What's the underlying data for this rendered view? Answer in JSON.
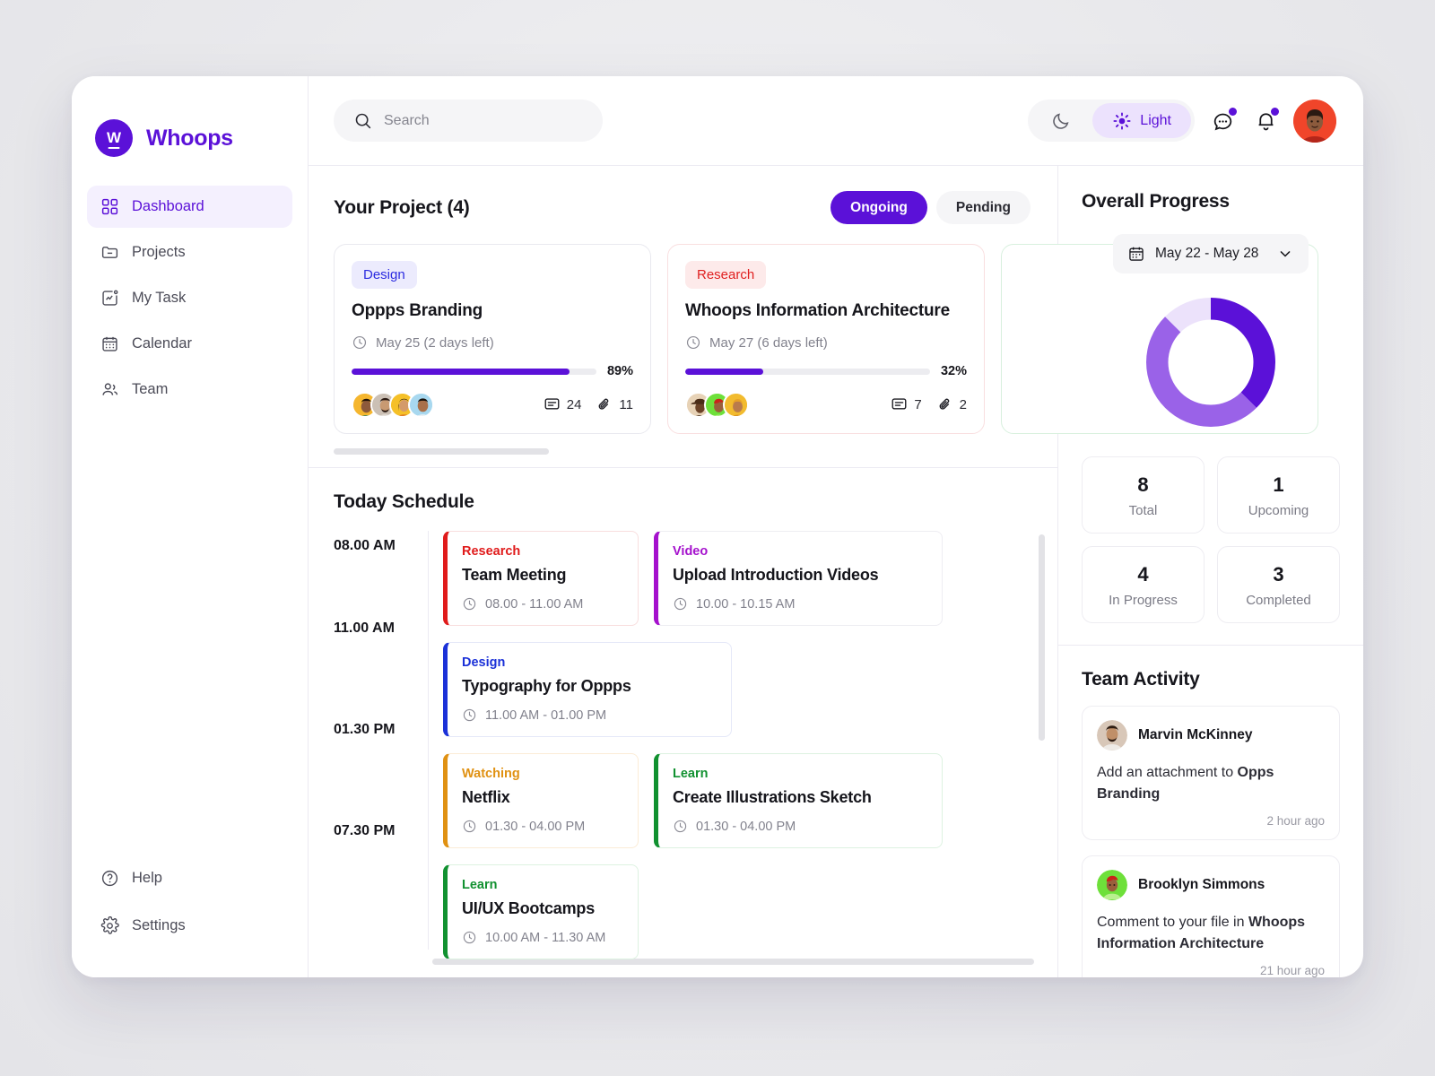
{
  "brand": {
    "name": "Whoops",
    "logo_letter": "W",
    "color": "#5b11d8"
  },
  "sidebar": {
    "items": [
      {
        "label": "Dashboard",
        "icon": "grid-icon",
        "active": true
      },
      {
        "label": "Projects",
        "icon": "folder-icon",
        "active": false
      },
      {
        "label": "My Task",
        "icon": "chart-square-icon",
        "active": false
      },
      {
        "label": "Calendar",
        "icon": "calendar-icon",
        "active": false
      },
      {
        "label": "Team",
        "icon": "users-icon",
        "active": false
      }
    ],
    "bottom_items": [
      {
        "label": "Help",
        "icon": "question-circle-icon"
      },
      {
        "label": "Settings",
        "icon": "gear-icon"
      }
    ]
  },
  "topbar": {
    "search": {
      "placeholder": "Search",
      "value": "",
      "icon": "search-icon"
    },
    "theme": {
      "dark_label": "",
      "light_label": "Light",
      "active": "light",
      "dark_icon": "moon-icon",
      "light_icon": "sun-icon"
    },
    "messages_icon": "chat-bubble-icon",
    "notifications_icon": "bell-icon",
    "avatar": "user-avatar"
  },
  "projects": {
    "title": "Your Project (4)",
    "filters": [
      {
        "label": "Ongoing",
        "active": true
      },
      {
        "label": "Pending",
        "active": false
      }
    ],
    "cards": [
      {
        "tag": "Design",
        "tag_type": "design",
        "title": "Oppps Branding",
        "due": "May 25 (2 days left)",
        "progress": 89,
        "progress_label": "89%",
        "comments": "24",
        "attachments": "11",
        "avatar_colors": [
          "#f5b62e",
          "#cbc0b5",
          "#f5c028",
          "#a8d8ef"
        ]
      },
      {
        "tag": "Research",
        "tag_type": "research",
        "title": "Whoops Information Architecture",
        "due": "May 27 (6 days left)",
        "progress": 32,
        "progress_label": "32%",
        "comments": "7",
        "attachments": "2",
        "avatar_colors": [
          "#e7d2b6",
          "#6ee03a",
          "#f2bb2e"
        ]
      }
    ]
  },
  "schedule": {
    "title": "Today Schedule",
    "rows": [
      {
        "time": "08.00 AM",
        "events": [
          {
            "category": "Research",
            "title": "Team Meeting",
            "time": "08.00 - 11.00 AM",
            "color": "#e01b1b",
            "bg_border": "#f8dede",
            "wide": false
          },
          {
            "category": "Video",
            "title": "Upload Introduction Videos",
            "time": "10.00 - 10.15 AM",
            "color": "#a511cd",
            "bg_border": "#eeedf2",
            "wide": true
          }
        ]
      },
      {
        "time": "11.00 AM",
        "events": [
          {
            "category": "Design",
            "title": "Typography for Oppps",
            "time": "11.00 AM - 01.00 PM",
            "color": "#1b31d8",
            "bg_border": "#e5e8f8",
            "wide": true
          }
        ]
      },
      {
        "time": "01.30 PM",
        "events": [
          {
            "category": "Watching",
            "title": "Netflix",
            "time": "01.30 - 04.00 PM",
            "color": "#e09112",
            "bg_border": "#fbecd6",
            "wide": false
          },
          {
            "category": "Learn",
            "title": "Create Illustrations Sketch",
            "time": "01.30 - 04.00 PM",
            "color": "#119130",
            "bg_border": "#ddf2e1",
            "wide": true
          }
        ]
      },
      {
        "time": "07.30 PM",
        "events": [
          {
            "category": "Learn",
            "title": "UI/UX Bootcamps",
            "time": "10.00 AM - 11.30 AM",
            "color": "#119130",
            "bg_border": "#ddf2e1",
            "wide": false
          }
        ]
      }
    ]
  },
  "overall_progress": {
    "title": "Overall Progress",
    "date_range": "May 22 - May 28",
    "calendar_icon": "calendar-icon",
    "chevron_icon": "chevron-down-icon",
    "stats": [
      {
        "value": "8",
        "label": "Total"
      },
      {
        "value": "1",
        "label": "Upcoming"
      },
      {
        "value": "4",
        "label": "In Progress"
      },
      {
        "value": "3",
        "label": "Completed"
      }
    ]
  },
  "chart_data": {
    "type": "pie",
    "title": "Overall Progress",
    "subtitle": "May 22 - May 28",
    "categories": [
      "Completed",
      "In Progress",
      "Upcoming"
    ],
    "values": [
      37.5,
      50,
      12.5
    ],
    "labels": [
      "3",
      "4",
      "1"
    ],
    "colors": [
      "#5b11d8",
      "#9a62e8",
      "#ece2fb"
    ],
    "total": 8,
    "legend": "none",
    "inner_radius_ratio": 0.66,
    "start_angle_deg": 0
  },
  "team_activity": {
    "title": "Team Activity",
    "items": [
      {
        "name": "Marvin McKinney",
        "text_prefix": "Add an attachment to ",
        "text_bold": "Opps Branding",
        "time": "2 hour ago",
        "avatar_color": "#d8c7b8"
      },
      {
        "name": "Brooklyn Simmons",
        "text_prefix": "Comment to your file in ",
        "text_bold": "Whoops Information Architecture",
        "time": "21 hour ago",
        "avatar_color": "#6ee03a"
      }
    ]
  }
}
